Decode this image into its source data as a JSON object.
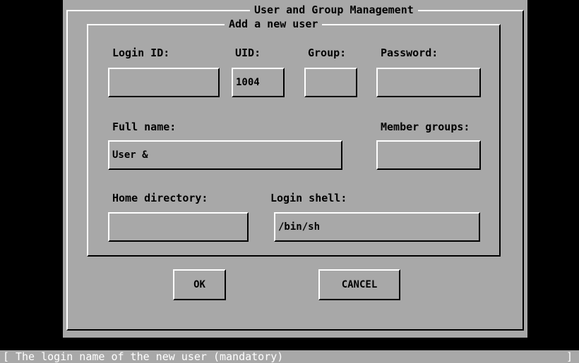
{
  "dialog": {
    "title": "User and Group Management",
    "section_title": "Add a new user"
  },
  "form": {
    "login_id": {
      "label": "Login ID:",
      "value": ""
    },
    "uid": {
      "label": "UID:",
      "value": "1004"
    },
    "group": {
      "label": "Group:",
      "value": ""
    },
    "password": {
      "label": "Password:",
      "value": ""
    },
    "full_name": {
      "label": "Full name:",
      "value": "User &"
    },
    "member_groups": {
      "label": "Member groups:",
      "value": ""
    },
    "home_directory": {
      "label": "Home directory:",
      "value": ""
    },
    "login_shell": {
      "label": "Login shell:",
      "value": "/bin/sh"
    }
  },
  "buttons": {
    "ok": "OK",
    "cancel": "CANCEL"
  },
  "status_bar": {
    "open_bracket": "[",
    "text": "The login name of the new user (mandatory)",
    "close_bracket": "]"
  },
  "colors": {
    "background": "#000000",
    "dialog": "#a8a8a8",
    "highlight": "#ffffff",
    "shadow": "#000000"
  }
}
